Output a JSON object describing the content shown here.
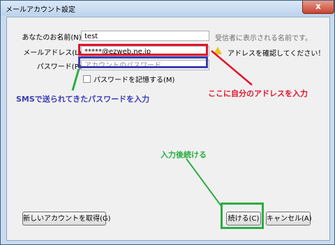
{
  "window": {
    "title": "メールアカウント設定",
    "close_glyph": "x"
  },
  "form": {
    "name_label": "あなたのお名前(N):",
    "name_value": "test",
    "name_hint": "受信者に表示される名前です。",
    "email_label": "メールアドレス(L):",
    "email_value": "*****@ezweb.ne.jp",
    "email_warning": "アドレスを確認してください！",
    "password_label": "パスワード(P):",
    "password_placeholder": "アカウントのパスワード",
    "remember_label": "パスワードを記憶する(M)"
  },
  "buttons": {
    "get_account": "新しいアカウントを取得(G)",
    "continue": "続ける(C)",
    "cancel": "キャンセル(A)"
  },
  "annotations": {
    "sms_note": "SMSで送られてきたパスワードを入力",
    "address_note": "ここに自分のアドレスを入力",
    "continue_note": "入力後続ける"
  },
  "colors": {
    "red": "#e0142a",
    "blue": "#3a3eb4",
    "green": "#2aac43"
  }
}
